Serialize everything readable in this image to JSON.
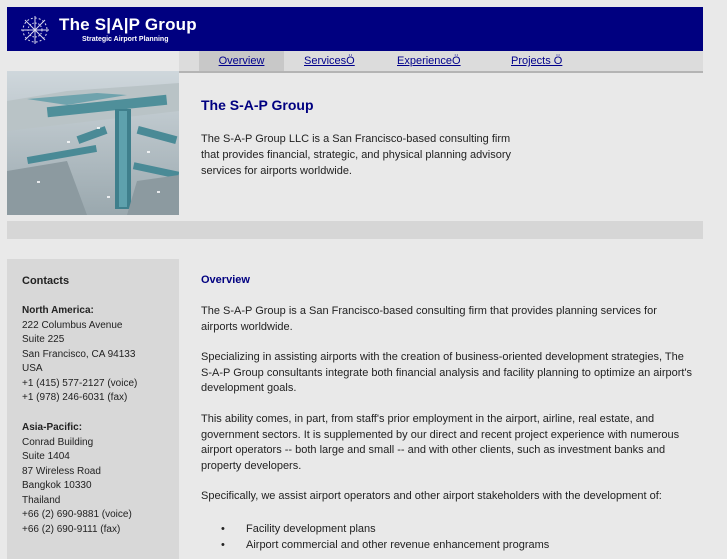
{
  "header": {
    "logo_name": "The S|A|P Group",
    "logo_tagline": "Strategic Airport Planning"
  },
  "nav": {
    "tabs": [
      {
        "label": "Overview"
      },
      {
        "label": "ServicesÖ"
      },
      {
        "label": "ExperienceÖ"
      },
      {
        "label": "Projects Ö"
      }
    ],
    "active": "Overview"
  },
  "hero": {
    "title": "The S-A-P Group",
    "text": "The S-A-P Group LLC is a San Francisco-based consulting firm that provides financial, strategic, and physical planning advisory services for airports worldwide."
  },
  "sidebar": {
    "title": "Contacts",
    "regions": [
      {
        "name": "North America:",
        "lines": [
          "222 Columbus Avenue",
          "Suite 225",
          "San Francisco, CA 94133",
          "USA",
          "+1 (415) 577-2127 (voice)",
          "+1 (978) 246-6031 (fax)"
        ]
      },
      {
        "name": "Asia-Pacific:",
        "lines": [
          "Conrad Building",
          "Suite 1404",
          "87 Wireless Road",
          "Bangkok 10330",
          "Thailand",
          "+66 (2) 690-9881 (voice)",
          "+66 (2) 690-9111 (fax)"
        ]
      }
    ]
  },
  "main": {
    "title": "Overview",
    "paragraphs": [
      "The S-A-P Group is a San Francisco-based consulting firm that provides planning services for airports worldwide.",
      "Specializing in assisting airports with the creation of business-oriented development strategies, The S-A-P Group consultants integrate both financial analysis and facility planning to optimize an airport's development goals.",
      "This ability comes, in part, from staff's prior employment in the airport, airline, real estate, and government sectors.  It is supplemented by our direct and recent project experience with numerous airport operators -- both large and small -- and with other clients, such as investment banks and property developers.",
      "Specifically, we assist airport operators and other airport stakeholders with the development of:"
    ],
    "bullets": [
      "Facility development plans",
      "Airport commercial and other revenue enhancement programs"
    ]
  },
  "colors": {
    "header_bg": "#000080",
    "heading": "#000080",
    "link": "#00008b",
    "page_bg": "#e9e9e9",
    "sidebar_bg": "#d8d8d8"
  }
}
